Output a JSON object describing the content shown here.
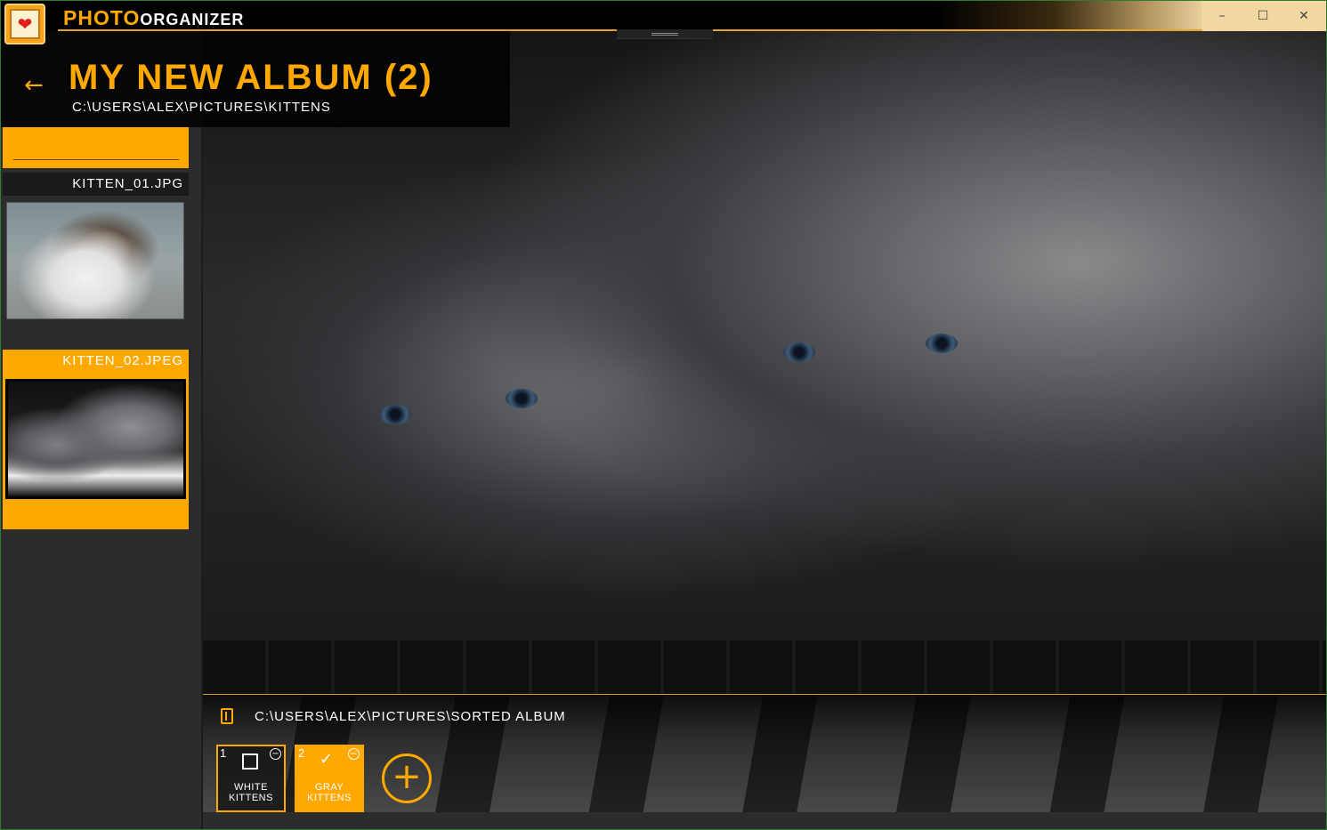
{
  "app": {
    "title_part1": "PHOTO",
    "title_part2": "ORGANIZER",
    "logo_icon": "hearts-photo-icon",
    "window_controls": {
      "minimize": "–",
      "maximize": "☐",
      "close": "✕"
    }
  },
  "album": {
    "back_icon": "arrow-left-icon",
    "back_glyph": "←",
    "title": "MY NEW ALBUM (2)",
    "source_path": "C:\\USERS\\ALEX\\PICTURES\\KITTENS"
  },
  "sidebar": {
    "items": [
      {
        "name": "KITTEN_01.JPG",
        "selected": false
      },
      {
        "name": "KITTEN_02.JPEG",
        "selected": true
      }
    ]
  },
  "bottom": {
    "folder_icon": "folder-icon",
    "destination_path": "C:\\USERS\\ALEX\\PICTURES\\SORTED ALBUM",
    "categories": [
      {
        "number": "1",
        "label": "WHITE KITTENS",
        "checked": false
      },
      {
        "number": "2",
        "label": "GRAY KITTENS",
        "checked": true
      }
    ],
    "add_glyph": "+"
  },
  "colors": {
    "accent": "#ffa800",
    "background": "#2c2c2c"
  }
}
